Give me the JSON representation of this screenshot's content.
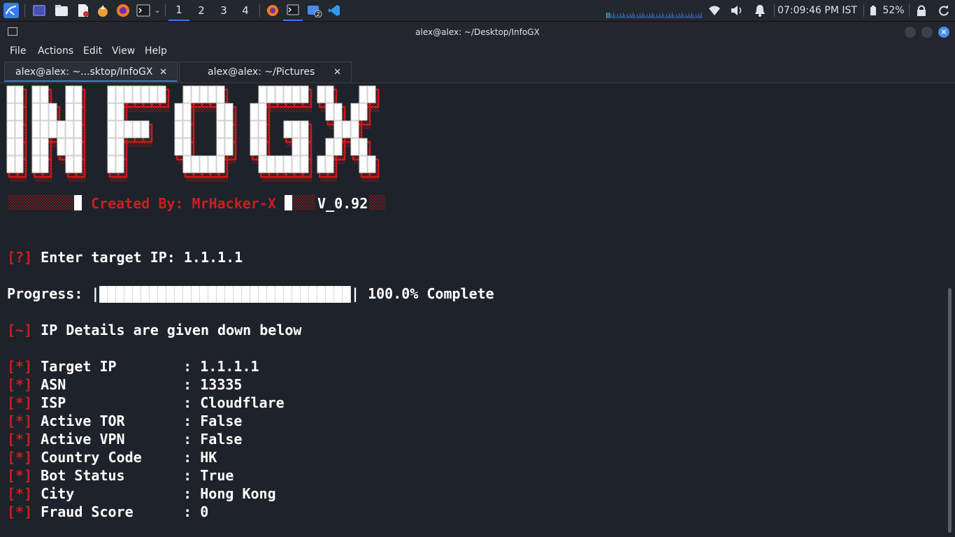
{
  "taskbar": {
    "workspaces": [
      "1",
      "2",
      "3",
      "4"
    ],
    "active_workspace": "1",
    "notification_count": "2",
    "clock": "07:09:46 PM IST",
    "battery": "52%",
    "icons": [
      "kali-menu-icon",
      "workspace-switcher-icon",
      "file-manager-icon",
      "text-editor-icon",
      "burpsuite-icon",
      "firefox-icon",
      "terminal-icon",
      "chevron-down-icon",
      "firefox-task-icon",
      "terminal-task-icon",
      "file-manager-task-icon",
      "vscode-task-icon",
      "network-monitor-icon",
      "wifi-icon",
      "volume-icon",
      "bell-icon",
      "battery-icon",
      "lock-icon",
      "refresh-icon"
    ]
  },
  "window": {
    "title": "alex@alex: ~/Desktop/InfoGX"
  },
  "menu": [
    "File",
    "Actions",
    "Edit",
    "View",
    "Help"
  ],
  "tabs": [
    {
      "label": "alex@alex: ~...sktop/InfoGX",
      "active": true
    },
    {
      "label": "alex@alex: ~/Pictures",
      "active": false
    }
  ],
  "banner": {
    "art_text": "INFOGX",
    "created_by": "Created By: MrHacker-X",
    "version": "V_0.92"
  },
  "prompt": {
    "tag": "[?]",
    "label": "Enter target IP:",
    "value": "1.1.1.1"
  },
  "progress": {
    "label": "Progress:",
    "percent_text": "100.0% Complete",
    "fraction": 1.0
  },
  "info_header": {
    "tag": "[~]",
    "text": "IP Details are given down below"
  },
  "details": [
    {
      "tag": "[*]",
      "key": "Target IP",
      "value": "1.1.1.1"
    },
    {
      "tag": "[*]",
      "key": "ASN",
      "value": "13335"
    },
    {
      "tag": "[*]",
      "key": "ISP",
      "value": "Cloudflare"
    },
    {
      "tag": "[*]",
      "key": "Active TOR",
      "value": "False"
    },
    {
      "tag": "[*]",
      "key": "Active VPN",
      "value": "False"
    },
    {
      "tag": "[*]",
      "key": "Country Code",
      "value": "HK"
    },
    {
      "tag": "[*]",
      "key": "Bot Status",
      "value": "True"
    },
    {
      "tag": "[*]",
      "key": "City",
      "value": "Hong Kong"
    },
    {
      "tag": "[*]",
      "key": "Fraud Score",
      "value": "0"
    }
  ],
  "colors": {
    "accent": "#367bf0",
    "tag_red": "#cc1e1e",
    "terminal_bg": "#1e222a",
    "text": "#ffffff"
  }
}
